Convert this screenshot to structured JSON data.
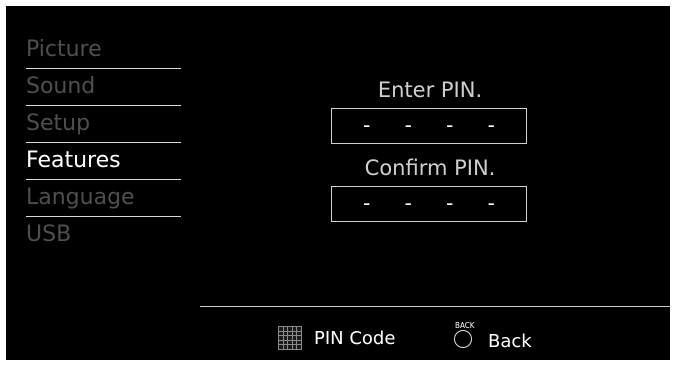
{
  "menu": {
    "items": [
      {
        "label": "Picture",
        "active": false
      },
      {
        "label": "Sound",
        "active": false
      },
      {
        "label": "Setup",
        "active": false
      },
      {
        "label": "Features",
        "active": true
      },
      {
        "label": "Language",
        "active": false
      },
      {
        "label": "USB",
        "active": false
      }
    ]
  },
  "dialog": {
    "enter_prompt": "Enter PIN.",
    "enter_digits": [
      "-",
      "-",
      "-",
      "-"
    ],
    "confirm_prompt": "Confirm PIN.",
    "confirm_digits": [
      "-",
      "-",
      "-",
      "-"
    ]
  },
  "footer": {
    "pin_code_label": "PIN Code",
    "pin_code_icon": "keypad-icon",
    "back_label": "Back",
    "back_icon": "back-button-icon",
    "back_icon_text": "BACK"
  },
  "colors": {
    "background": "#000000",
    "active_text": "#ffffff",
    "inactive_text": "#4e4e4e"
  }
}
